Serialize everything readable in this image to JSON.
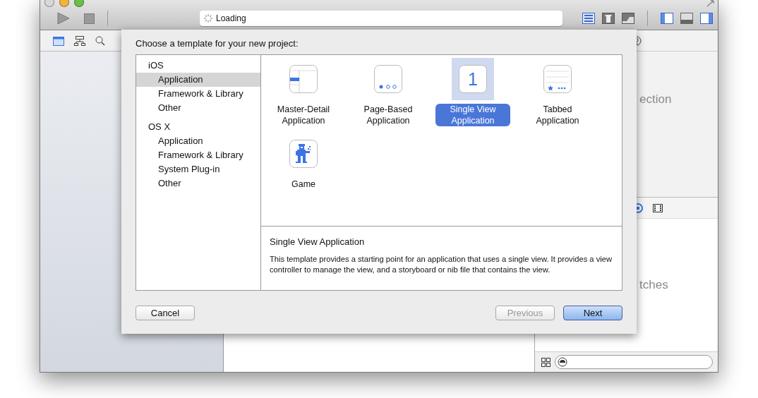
{
  "toolbar": {
    "activity": "Loading"
  },
  "utility": {
    "texts": [
      "ection",
      "tches"
    ]
  },
  "sheet": {
    "title": "Choose a template for your new project:",
    "categories": [
      {
        "label": "iOS",
        "children": [
          {
            "label": "Application",
            "selected": true
          },
          {
            "label": "Framework & Library",
            "selected": false
          },
          {
            "label": "Other",
            "selected": false
          }
        ]
      },
      {
        "label": "OS X",
        "children": [
          {
            "label": "Application",
            "selected": false
          },
          {
            "label": "Framework & Library",
            "selected": false
          },
          {
            "label": "System Plug-in",
            "selected": false
          },
          {
            "label": "Other",
            "selected": false
          }
        ]
      }
    ],
    "templates": [
      {
        "kind": "master-detail",
        "label": "Master-Detail Application",
        "selected": false
      },
      {
        "kind": "page-based",
        "label": "Page-Based Application",
        "selected": false
      },
      {
        "kind": "single-view",
        "label": "Single View Application",
        "selected": true,
        "glyph": "1"
      },
      {
        "kind": "tabbed",
        "label": "Tabbed Application",
        "selected": false
      },
      {
        "kind": "game",
        "label": "Game",
        "selected": false
      }
    ],
    "description": {
      "title": "Single View Application",
      "body": "This template provides a starting point for an application that uses a single view. It provides a view controller to manage the view, and a storyboard or nib file that contains the view."
    },
    "buttons": [
      {
        "kind": "cancel",
        "label": "Cancel",
        "disabled": false,
        "default": false
      },
      {
        "kind": "previous",
        "label": "Previous",
        "disabled": true,
        "default": false
      },
      {
        "kind": "next",
        "label": "Next",
        "disabled": false,
        "default": true
      }
    ]
  }
}
